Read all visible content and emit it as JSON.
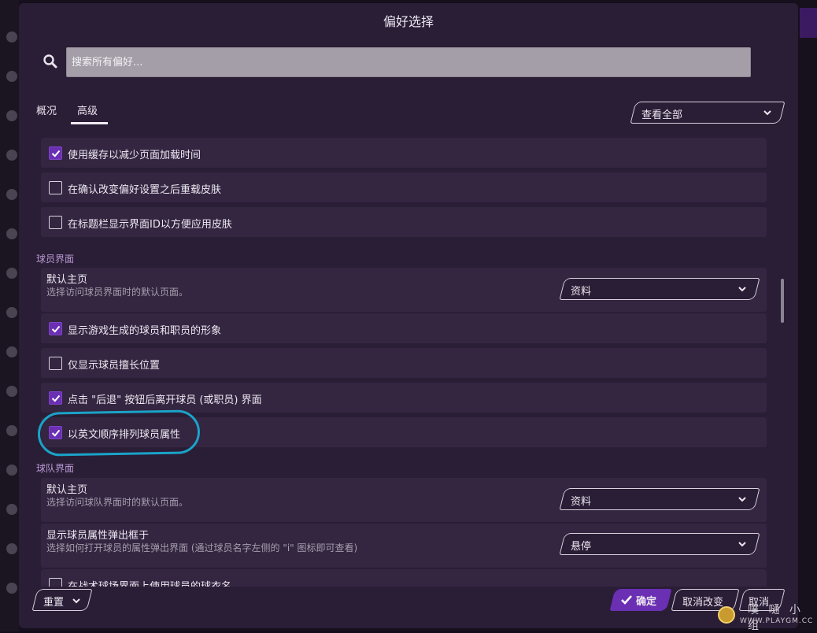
{
  "dialog": {
    "title": "偏好选择"
  },
  "search": {
    "placeholder": "搜索所有偏好..."
  },
  "tabs": [
    {
      "label": "概况",
      "active": false
    },
    {
      "label": "高级",
      "active": true
    }
  ],
  "filter": {
    "selected": "查看全部"
  },
  "general_rows": [
    {
      "label": "使用缓存以减少页面加载时间",
      "checked": true
    },
    {
      "label": "在确认改变偏好设置之后重载皮肤",
      "checked": false
    },
    {
      "label": "在标题栏显示界面ID以方便应用皮肤",
      "checked": false
    }
  ],
  "player_section": {
    "heading": "球员界面",
    "default_home": {
      "title": "默认主页",
      "subtitle": "选择访问球员界面时的默认页面。",
      "selected": "资料"
    },
    "rows": [
      {
        "label": "显示游戏生成的球员和职员的形象",
        "checked": true
      },
      {
        "label": "仅显示球员擅长位置",
        "checked": false
      },
      {
        "label": "点击 \"后退\" 按钮后离开球员 (或职员) 界面",
        "checked": true
      },
      {
        "label": "以英文顺序排列球员属性",
        "checked": true
      }
    ]
  },
  "team_section": {
    "heading": "球队界面",
    "default_home": {
      "title": "默认主页",
      "subtitle": "选择访问球队界面时的默认页面。",
      "selected": "资料"
    },
    "attr_popup": {
      "title": "显示球员属性弹出框于",
      "subtitle": "选择如何打开球员的属性弹出界面 (通过球员名字左侧的 \"i\" 图标即可查看)",
      "selected": "悬停"
    },
    "partial_row": {
      "label": "在战术球场界面上使用球员的球衣名",
      "checked": false
    }
  },
  "footer": {
    "reset_label": "重置",
    "confirm_label": "确定",
    "revert_label": "取消改变",
    "cancel_label": "取消"
  },
  "watermark": {
    "cn": "噗 嗵 小 组",
    "en": "WWW.PLAYGM.CC"
  },
  "colors": {
    "accent": "#6a2fb3",
    "dialog_bg": "#2a1d36",
    "row_bg": "#342541",
    "annotation": "#1aa3c8"
  }
}
